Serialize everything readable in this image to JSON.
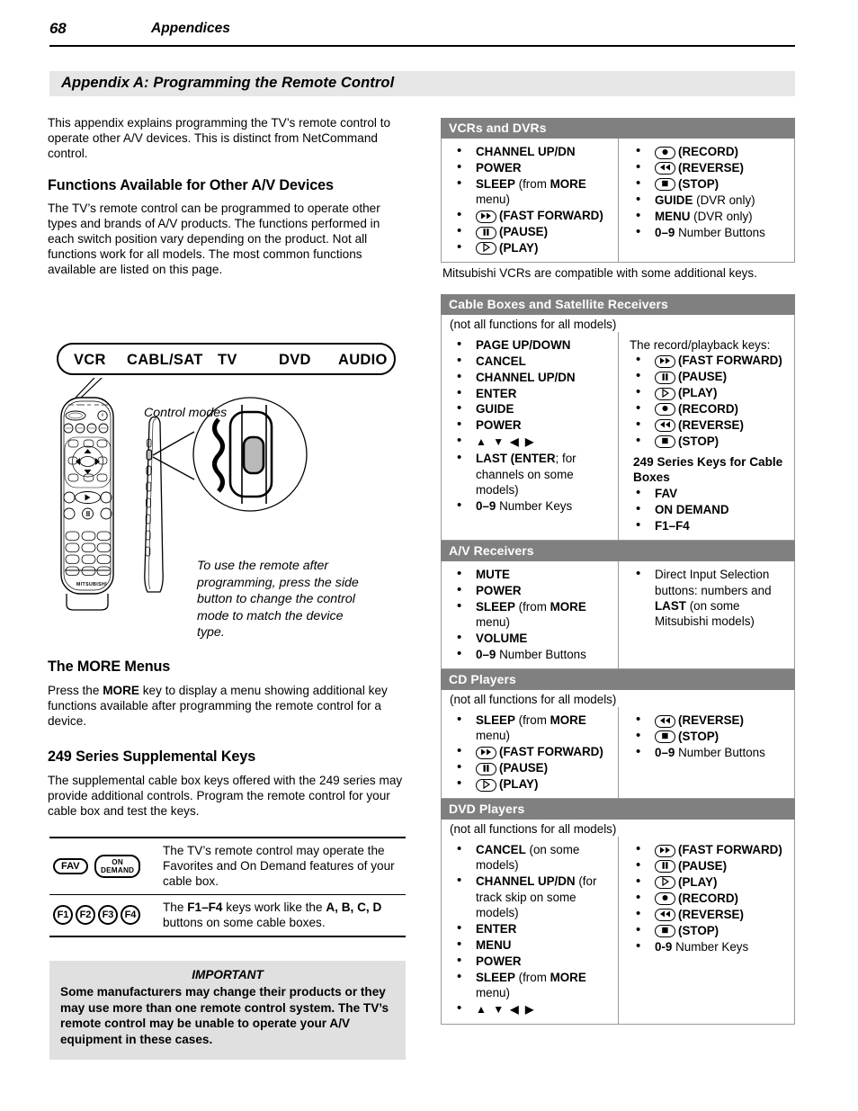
{
  "page": {
    "number": "68",
    "running_title": "Appendices",
    "appendix_title": "Appendix A:  Programming the Remote Control"
  },
  "left": {
    "intro": "This appendix explains programming the TV’s remote control to operate other A/V devices.  This is distinct from NetCommand control.",
    "functions_heading": "Functions Available for Other A/V Devices",
    "functions_body": "The TV’s remote control can be programmed to operate other types and brands of A/V products. The functions performed in each switch position vary depending on the product.  Not all functions work for all models.  The most common functions available are listed on this page.",
    "mode_bar": {
      "modes": [
        "VCR",
        "CABL/SAT",
        "TV",
        "DVD",
        "AUDIO"
      ],
      "caption": "Control modes"
    },
    "side_button_caption": "To use the remote after programming, press the side button to change the control mode to match the device type.",
    "more_menus_heading": "The MORE Menus",
    "more_menus_body_pre": "Press the ",
    "more_menus_key": "MORE",
    "more_menus_body_post": " key to display a menu showing additional key functions available after programming the remote control for a device.",
    "series_heading": "249 Series Supplemental Keys",
    "series_body": "The supplemental cable box keys offered with the 249 series may provide additional controls.  Program the remote control for your cable box and test the keys.",
    "keys_table": [
      {
        "icons": [
          "FAV",
          "ON DEMAND"
        ],
        "description": "The TV’s remote control may operate the Favorites and On Demand features of your cable box."
      },
      {
        "icons": [
          "F1",
          "F2",
          "F3",
          "F4"
        ],
        "description_parts": [
          "The ",
          "F1–F4",
          " keys work like the  ",
          "A, B, C, D",
          " buttons on some cable boxes."
        ]
      }
    ],
    "important": {
      "title": "IMPORTANT",
      "body": "Some manufacturers may change their products or they may use more than one remote control system.  The TV’s remote control may be unable to operate your A/V equipment in these cases."
    }
  },
  "right": {
    "tables": [
      {
        "heading": "VCRs and DVRs",
        "note": null,
        "left_items": [
          {
            "text": "CHANNEL UP/DN",
            "bold": true
          },
          {
            "text": "POWER",
            "bold": true
          },
          {
            "bold_part": "SLEEP",
            "rest_pre": " (from ",
            "rest_bold": "MORE",
            "rest_post": " menu)"
          },
          {
            "icon": "fast-forward",
            "text": "(FAST FORWARD)",
            "bold": true
          },
          {
            "icon": "pause",
            "text": "(PAUSE)",
            "bold": true
          },
          {
            "icon": "play",
            "text": "(PLAY)",
            "bold": true
          }
        ],
        "right_items": [
          {
            "icon": "record",
            "text": "(RECORD)",
            "bold": true
          },
          {
            "icon": "reverse",
            "text": "(REVERSE)",
            "bold": true
          },
          {
            "icon": "stop",
            "text": "(STOP)",
            "bold": true
          },
          {
            "bold_part": "GUIDE",
            "rest_post": " (DVR only)"
          },
          {
            "bold_part": "MENU",
            "rest_post": " (DVR only)"
          },
          {
            "bold_part": "0–9",
            "rest_post": " Number Buttons"
          }
        ],
        "caption_under": "Mitsubishi VCRs are compatible with some additional keys."
      },
      {
        "heading": "Cable Boxes and Satellite Receivers",
        "note": "(not all functions for all models)",
        "left_items": [
          {
            "text": "PAGE UP/DOWN",
            "bold": true
          },
          {
            "text": "CANCEL",
            "bold": true
          },
          {
            "text": "CHANNEL UP/DN",
            "bold": true
          },
          {
            "text": "ENTER",
            "bold": true
          },
          {
            "text": "GUIDE",
            "bold": true
          },
          {
            "text": "POWER",
            "bold": true
          },
          {
            "arrows": "▲ ▼ ◀ ▶"
          },
          {
            "bold_part": "LAST (ENTER",
            "rest_post": "; for channels on some models)",
            "mixed": true
          },
          {
            "bold_part": "0–9",
            "rest_post": " Number Keys"
          }
        ],
        "right_header": "The record/playback keys:",
        "right_items": [
          {
            "icon": "fast-forward",
            "text": "(FAST FORWARD)",
            "bold": true
          },
          {
            "icon": "pause",
            "text": "(PAUSE)",
            "bold": true
          },
          {
            "icon": "play",
            "text": "(PLAY)",
            "bold": true
          },
          {
            "icon": "record",
            "text": "(RECORD)",
            "bold": true
          },
          {
            "icon": "reverse",
            "text": "(REVERSE)",
            "bold": true
          },
          {
            "icon": "stop",
            "text": "(STOP)",
            "bold": true
          }
        ],
        "right_subhead": "249 Series Keys for Cable Boxes",
        "right_sub_items": [
          {
            "text": "FAV",
            "bold": true
          },
          {
            "text": "ON DEMAND",
            "bold": true
          },
          {
            "text": "F1–F4",
            "bold": true
          }
        ]
      },
      {
        "heading": "A/V Receivers",
        "note": null,
        "left_items": [
          {
            "text": "MUTE",
            "bold": true
          },
          {
            "text": "POWER",
            "bold": true
          },
          {
            "bold_part": "SLEEP",
            "rest_pre": " (from ",
            "rest_bold": "MORE",
            "rest_post": " menu)"
          },
          {
            "text": "VOLUME",
            "bold": true
          },
          {
            "bold_part": "0–9",
            "rest_post": " Number Buttons"
          }
        ],
        "right_items": [
          {
            "plain": "Direct Input Selection buttons:  numbers and ",
            "inline_bold": "LAST",
            "plain_post": " (on some Mitsubishi models)"
          }
        ]
      },
      {
        "heading": "CD Players",
        "note": "(not all functions for all models)",
        "left_items": [
          {
            "bold_part": "SLEEP",
            "rest_pre": " (from ",
            "rest_bold": "MORE",
            "rest_post": " menu)"
          },
          {
            "icon": "fast-forward",
            "text": "(FAST FORWARD)",
            "bold": true
          },
          {
            "icon": "pause",
            "text": "(PAUSE)",
            "bold": true
          },
          {
            "icon": "play",
            "text": "(PLAY)",
            "bold": true
          }
        ],
        "right_items": [
          {
            "icon": "reverse",
            "text": "(REVERSE)",
            "bold": true
          },
          {
            "icon": "stop",
            "text": "(STOP)",
            "bold": true
          },
          {
            "bold_part": "0–9",
            "rest_post": " Number Buttons"
          }
        ]
      },
      {
        "heading": "DVD Players",
        "note": "(not all functions for all models)",
        "left_items": [
          {
            "bold_part": "CANCEL",
            "rest_post": " (on some models)"
          },
          {
            "bold_part": "CHANNEL UP/DN",
            "rest_post": " (for track skip on some models)"
          },
          {
            "text": "ENTER",
            "bold": true
          },
          {
            "text": "MENU",
            "bold": true
          },
          {
            "text": "POWER",
            "bold": true
          },
          {
            "bold_part": "SLEEP",
            "rest_pre": " (from ",
            "rest_bold": "MORE",
            "rest_post": " menu)"
          },
          {
            "arrows": "▲ ▼ ◀ ▶"
          }
        ],
        "right_items": [
          {
            "icon": "fast-forward",
            "text": "(FAST FORWARD)",
            "bold": true
          },
          {
            "icon": "pause",
            "text": "(PAUSE)",
            "bold": true
          },
          {
            "icon": "play",
            "text": "(PLAY)",
            "bold": true
          },
          {
            "icon": "record",
            "text": "(RECORD)",
            "bold": true
          },
          {
            "icon": "reverse",
            "text": "(REVERSE)",
            "bold": true
          },
          {
            "icon": "stop",
            "text": "(STOP)",
            "bold": true
          },
          {
            "bold_part": "0-9",
            "rest_post": " Number Keys"
          }
        ]
      }
    ]
  },
  "colors": {
    "table_header_bg": "#808080",
    "table_header_text": "#ffffff",
    "appendix_bar_bg": "#e6e6e6",
    "important_bg": "#e0e0e0",
    "table_border": "#9a9a9a"
  }
}
